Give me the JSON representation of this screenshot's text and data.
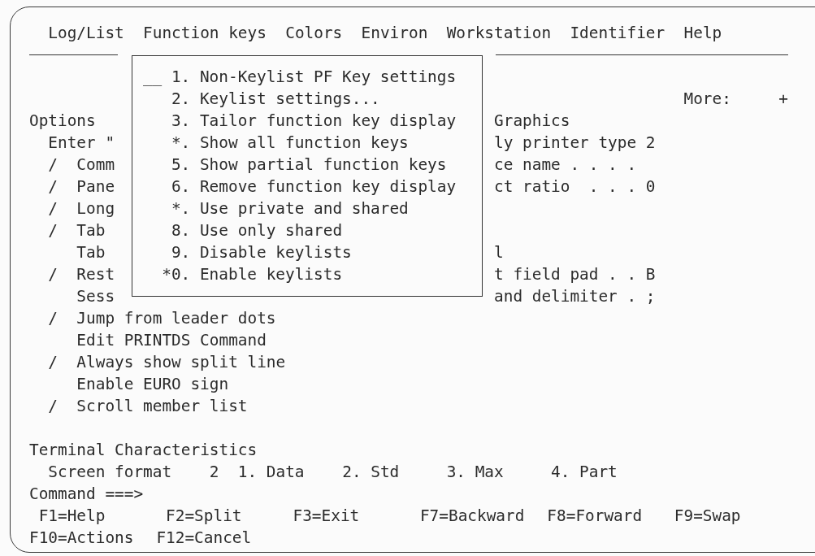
{
  "menu_bar": {
    "items": [
      "Log/List",
      "Function keys",
      "Colors",
      "Environ",
      "Workstation",
      "Identifier",
      "Help"
    ]
  },
  "pulldown": {
    "selection_field": "__",
    "items": [
      {
        "number": "1.",
        "label": "Non-Keylist PF Key settings"
      },
      {
        "number": "2.",
        "label": "Keylist settings..."
      },
      {
        "number": "3.",
        "label": "Tailor function key display"
      },
      {
        "number": "*.",
        "label": "Show all function keys"
      },
      {
        "number": "5.",
        "label": "Show partial function keys"
      },
      {
        "number": "6.",
        "label": "Remove function key display"
      },
      {
        "number": "*.",
        "label": "Use private and shared"
      },
      {
        "number": "8.",
        "label": "Use only shared"
      },
      {
        "number": "9.",
        "label": "Disable keylists"
      },
      {
        "number": "*0.",
        "label": "Enable keylists"
      }
    ]
  },
  "more_indicator": {
    "label": "More:",
    "sign": "+"
  },
  "settings": {
    "check_mark": "/",
    "rows": [
      {
        "kind": "heading",
        "left": "Options",
        "right": "Graphics"
      },
      {
        "kind": "text",
        "left": "Enter \"",
        "right": "ly printer type 2"
      },
      {
        "kind": "option",
        "checked": true,
        "left": "Comm",
        "right": "ce name . . . ."
      },
      {
        "kind": "option",
        "checked": true,
        "left": "Pane",
        "right": "ct ratio  . . . 0"
      },
      {
        "kind": "option",
        "checked": true,
        "left": "Long"
      },
      {
        "kind": "option",
        "checked": true,
        "left": "Tab"
      },
      {
        "kind": "option",
        "checked": false,
        "left": "Tab",
        "right": "l"
      },
      {
        "kind": "option",
        "checked": true,
        "left": "Rest",
        "right": "t field pad . . B"
      },
      {
        "kind": "option",
        "checked": false,
        "left": "Sess",
        "right": "and delimiter . ;"
      },
      {
        "kind": "option",
        "checked": true,
        "left": "Jump from leader dots"
      },
      {
        "kind": "option",
        "checked": false,
        "left": "Edit PRINTDS Command"
      },
      {
        "kind": "option",
        "checked": true,
        "left": "Always show split line"
      },
      {
        "kind": "option",
        "checked": false,
        "left": "Enable EURO sign"
      },
      {
        "kind": "option",
        "checked": true,
        "left": "Scroll member list"
      }
    ]
  },
  "terminal": {
    "title": "Terminal Characteristics",
    "field_label": "Screen format",
    "value": "2",
    "choices": [
      "1. Data",
      "2. Std",
      "3. Max",
      "4. Part"
    ]
  },
  "command": {
    "label": "Command ===>"
  },
  "function_key_rows": [
    {
      "keys": [
        "F1=Help",
        "F2=Split",
        "F3=Exit",
        "F7=Backward",
        "F8=Forward",
        "F9=Swap"
      ]
    },
    {
      "keys": [
        "F10=Actions",
        "F12=Cancel"
      ]
    }
  ]
}
